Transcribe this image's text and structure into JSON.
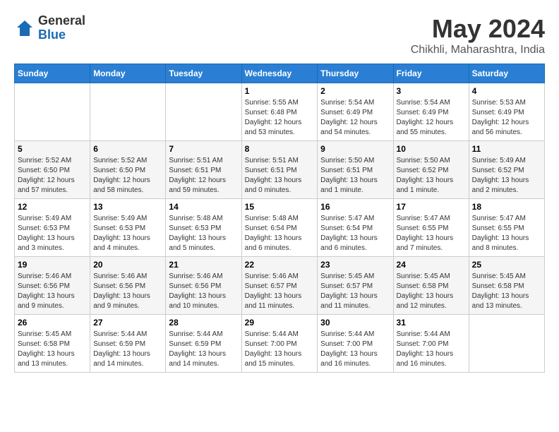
{
  "logo": {
    "general": "General",
    "blue": "Blue"
  },
  "title": "May 2024",
  "subtitle": "Chikhli, Maharashtra, India",
  "days_of_week": [
    "Sunday",
    "Monday",
    "Tuesday",
    "Wednesday",
    "Thursday",
    "Friday",
    "Saturday"
  ],
  "weeks": [
    [
      {
        "day": "",
        "info": ""
      },
      {
        "day": "",
        "info": ""
      },
      {
        "day": "",
        "info": ""
      },
      {
        "day": "1",
        "info": "Sunrise: 5:55 AM\nSunset: 6:48 PM\nDaylight: 12 hours\nand 53 minutes."
      },
      {
        "day": "2",
        "info": "Sunrise: 5:54 AM\nSunset: 6:49 PM\nDaylight: 12 hours\nand 54 minutes."
      },
      {
        "day": "3",
        "info": "Sunrise: 5:54 AM\nSunset: 6:49 PM\nDaylight: 12 hours\nand 55 minutes."
      },
      {
        "day": "4",
        "info": "Sunrise: 5:53 AM\nSunset: 6:49 PM\nDaylight: 12 hours\nand 56 minutes."
      }
    ],
    [
      {
        "day": "5",
        "info": "Sunrise: 5:52 AM\nSunset: 6:50 PM\nDaylight: 12 hours\nand 57 minutes."
      },
      {
        "day": "6",
        "info": "Sunrise: 5:52 AM\nSunset: 6:50 PM\nDaylight: 12 hours\nand 58 minutes."
      },
      {
        "day": "7",
        "info": "Sunrise: 5:51 AM\nSunset: 6:51 PM\nDaylight: 12 hours\nand 59 minutes."
      },
      {
        "day": "8",
        "info": "Sunrise: 5:51 AM\nSunset: 6:51 PM\nDaylight: 13 hours\nand 0 minutes."
      },
      {
        "day": "9",
        "info": "Sunrise: 5:50 AM\nSunset: 6:51 PM\nDaylight: 13 hours\nand 1 minute."
      },
      {
        "day": "10",
        "info": "Sunrise: 5:50 AM\nSunset: 6:52 PM\nDaylight: 13 hours\nand 1 minute."
      },
      {
        "day": "11",
        "info": "Sunrise: 5:49 AM\nSunset: 6:52 PM\nDaylight: 13 hours\nand 2 minutes."
      }
    ],
    [
      {
        "day": "12",
        "info": "Sunrise: 5:49 AM\nSunset: 6:53 PM\nDaylight: 13 hours\nand 3 minutes."
      },
      {
        "day": "13",
        "info": "Sunrise: 5:49 AM\nSunset: 6:53 PM\nDaylight: 13 hours\nand 4 minutes."
      },
      {
        "day": "14",
        "info": "Sunrise: 5:48 AM\nSunset: 6:53 PM\nDaylight: 13 hours\nand 5 minutes."
      },
      {
        "day": "15",
        "info": "Sunrise: 5:48 AM\nSunset: 6:54 PM\nDaylight: 13 hours\nand 6 minutes."
      },
      {
        "day": "16",
        "info": "Sunrise: 5:47 AM\nSunset: 6:54 PM\nDaylight: 13 hours\nand 6 minutes."
      },
      {
        "day": "17",
        "info": "Sunrise: 5:47 AM\nSunset: 6:55 PM\nDaylight: 13 hours\nand 7 minutes."
      },
      {
        "day": "18",
        "info": "Sunrise: 5:47 AM\nSunset: 6:55 PM\nDaylight: 13 hours\nand 8 minutes."
      }
    ],
    [
      {
        "day": "19",
        "info": "Sunrise: 5:46 AM\nSunset: 6:56 PM\nDaylight: 13 hours\nand 9 minutes."
      },
      {
        "day": "20",
        "info": "Sunrise: 5:46 AM\nSunset: 6:56 PM\nDaylight: 13 hours\nand 9 minutes."
      },
      {
        "day": "21",
        "info": "Sunrise: 5:46 AM\nSunset: 6:56 PM\nDaylight: 13 hours\nand 10 minutes."
      },
      {
        "day": "22",
        "info": "Sunrise: 5:46 AM\nSunset: 6:57 PM\nDaylight: 13 hours\nand 11 minutes."
      },
      {
        "day": "23",
        "info": "Sunrise: 5:45 AM\nSunset: 6:57 PM\nDaylight: 13 hours\nand 11 minutes."
      },
      {
        "day": "24",
        "info": "Sunrise: 5:45 AM\nSunset: 6:58 PM\nDaylight: 13 hours\nand 12 minutes."
      },
      {
        "day": "25",
        "info": "Sunrise: 5:45 AM\nSunset: 6:58 PM\nDaylight: 13 hours\nand 13 minutes."
      }
    ],
    [
      {
        "day": "26",
        "info": "Sunrise: 5:45 AM\nSunset: 6:58 PM\nDaylight: 13 hours\nand 13 minutes."
      },
      {
        "day": "27",
        "info": "Sunrise: 5:44 AM\nSunset: 6:59 PM\nDaylight: 13 hours\nand 14 minutes."
      },
      {
        "day": "28",
        "info": "Sunrise: 5:44 AM\nSunset: 6:59 PM\nDaylight: 13 hours\nand 14 minutes."
      },
      {
        "day": "29",
        "info": "Sunrise: 5:44 AM\nSunset: 7:00 PM\nDaylight: 13 hours\nand 15 minutes."
      },
      {
        "day": "30",
        "info": "Sunrise: 5:44 AM\nSunset: 7:00 PM\nDaylight: 13 hours\nand 16 minutes."
      },
      {
        "day": "31",
        "info": "Sunrise: 5:44 AM\nSunset: 7:00 PM\nDaylight: 13 hours\nand 16 minutes."
      },
      {
        "day": "",
        "info": ""
      }
    ]
  ]
}
